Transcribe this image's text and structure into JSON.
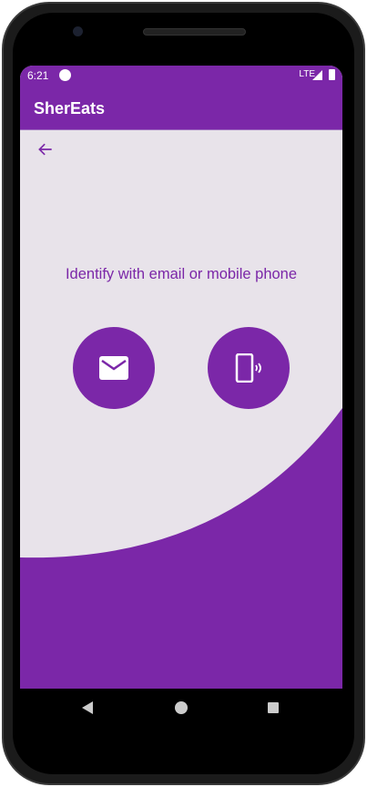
{
  "status_bar": {
    "time": "6:21",
    "network": "LTE"
  },
  "app_bar": {
    "title": "SherEats"
  },
  "main": {
    "prompt": "Identify with email or mobile phone",
    "options": [
      {
        "icon": "email-icon"
      },
      {
        "icon": "phone-icon"
      }
    ]
  },
  "colors": {
    "primary": "#7B27A8",
    "background": "#E8E3EA"
  }
}
